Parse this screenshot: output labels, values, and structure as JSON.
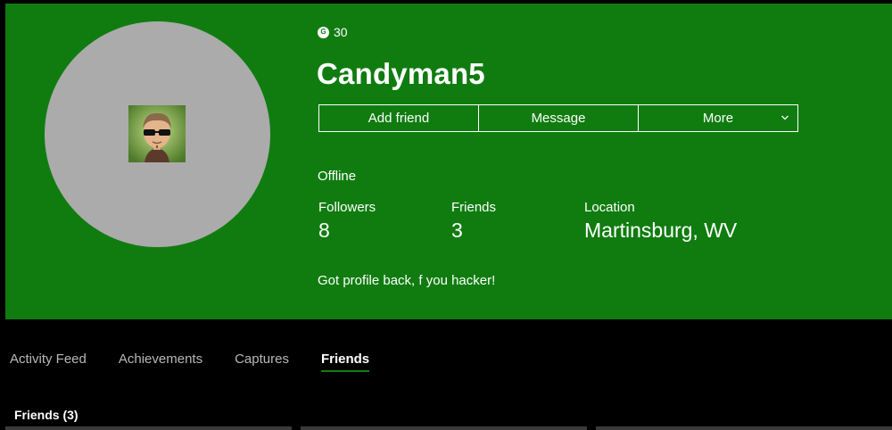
{
  "profile": {
    "gamerscore": "30",
    "gamerscore_icon": "gamerscore-g-icon",
    "gamertag": "Candyman5",
    "presence": "Offline",
    "bio": "Got profile back, f you hacker!",
    "avatar_bg_color": "#ababab"
  },
  "actions": {
    "add_friend": "Add friend",
    "message": "Message",
    "more": "More"
  },
  "stats": [
    {
      "label": "Followers",
      "value": "8"
    },
    {
      "label": "Friends",
      "value": "3"
    },
    {
      "label": "Location",
      "value": "Martinsburg, WV"
    }
  ],
  "tabs": [
    {
      "label": "Activity Feed",
      "active": false
    },
    {
      "label": "Achievements",
      "active": false
    },
    {
      "label": "Captures",
      "active": false
    },
    {
      "label": "Friends",
      "active": true
    }
  ],
  "friends_section": {
    "title": "Friends (3)"
  },
  "theme": {
    "accent": "#107c10",
    "background": "#000000",
    "inactive_tab_text": "#b8b8b8"
  }
}
